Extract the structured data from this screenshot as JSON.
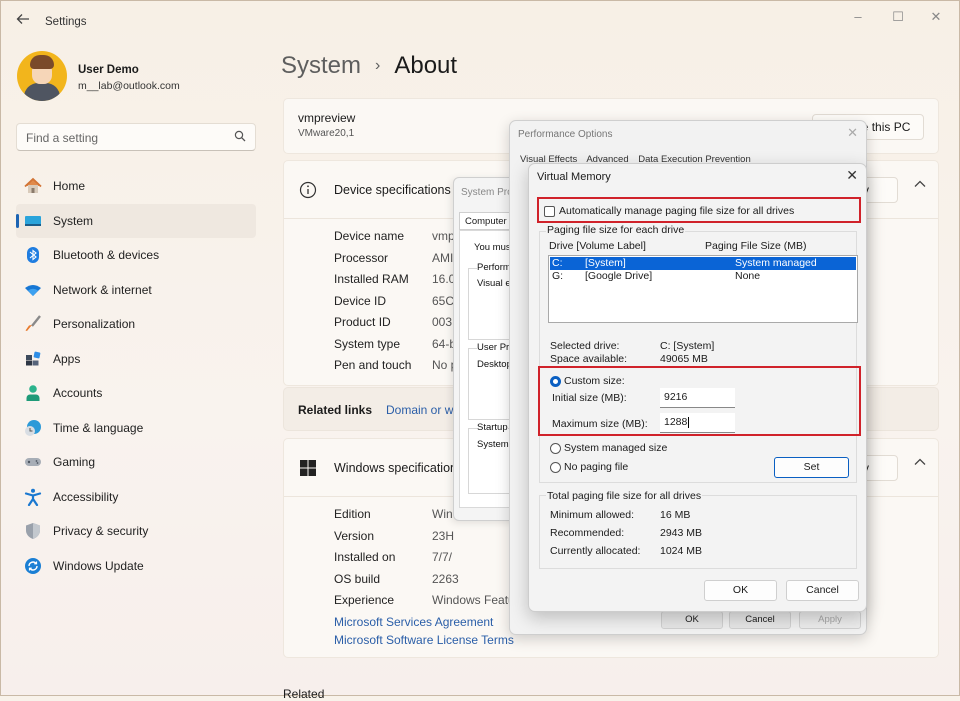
{
  "titlebar": {
    "app_title": "Settings",
    "back_icon": "arrow-left",
    "minimize_icon": "–",
    "maximize_icon": "☐",
    "close_icon": "✕"
  },
  "user": {
    "name": "User Demo",
    "email": "m__lab@outlook.com"
  },
  "search": {
    "placeholder": "Find a setting",
    "icon": "search-icon"
  },
  "sidebar": {
    "items": [
      {
        "label": "Home",
        "icon": "home-icon",
        "active": false
      },
      {
        "label": "System",
        "icon": "system-icon",
        "active": true
      },
      {
        "label": "Bluetooth & devices",
        "icon": "bluetooth-icon",
        "active": false
      },
      {
        "label": "Network & internet",
        "icon": "wifi-icon",
        "active": false
      },
      {
        "label": "Personalization",
        "icon": "brush-icon",
        "active": false
      },
      {
        "label": "Apps",
        "icon": "apps-icon",
        "active": false
      },
      {
        "label": "Accounts",
        "icon": "accounts-icon",
        "active": false
      },
      {
        "label": "Time & language",
        "icon": "time-language-icon",
        "active": false
      },
      {
        "label": "Gaming",
        "icon": "gamepad-icon",
        "active": false
      },
      {
        "label": "Accessibility",
        "icon": "accessibility-icon",
        "active": false
      },
      {
        "label": "Privacy & security",
        "icon": "shield-icon",
        "active": false
      },
      {
        "label": "Windows Update",
        "icon": "update-icon",
        "active": false
      }
    ]
  },
  "breadcrumb": {
    "parent": "System",
    "separator": "›",
    "current": "About"
  },
  "pc_card": {
    "name": "vmpreview",
    "model": "VMware20,1",
    "rename_label": "Rename this PC"
  },
  "device_specs": {
    "title": "Device specifications",
    "copy_label": "Copy",
    "rows": [
      {
        "label": "Device name",
        "value": "vmp"
      },
      {
        "label": "Processor",
        "value": "AMI"
      },
      {
        "label": "Installed RAM",
        "value": "16.0"
      },
      {
        "label": "Device ID",
        "value": "65C"
      },
      {
        "label": "Product ID",
        "value": "003"
      },
      {
        "label": "System type",
        "value": "64-b"
      },
      {
        "label": "Pen and touch",
        "value": "No p"
      }
    ]
  },
  "related_links": {
    "label": "Related links",
    "link": "Domain or w"
  },
  "windows_specs": {
    "title": "Windows specifications",
    "copy_label": "Copy",
    "rows": [
      {
        "label": "Edition",
        "value": "Win"
      },
      {
        "label": "Version",
        "value": "23H"
      },
      {
        "label": "Installed on",
        "value": "7/7/"
      },
      {
        "label": "OS build",
        "value": "2263"
      },
      {
        "label": "Experience",
        "value": "Windows Featu"
      }
    ],
    "links": [
      "Microsoft Services Agreement",
      "Microsoft Software License Terms"
    ]
  },
  "related_footer": "Related",
  "system_properties": {
    "title": "System Pro",
    "tab": "Computer N",
    "intro": "You mus",
    "groups": [
      {
        "label": "Perform",
        "text": "Visual e"
      },
      {
        "label": "User Pr",
        "text": "Desktop"
      },
      {
        "label": "Startup",
        "text": "System"
      }
    ]
  },
  "performance_options": {
    "title": "Performance Options",
    "tabs": [
      "Visual Effects",
      "Advanced",
      "Data Execution Prevention"
    ],
    "buttons": {
      "ok": "OK",
      "cancel": "Cancel",
      "apply": "Apply"
    }
  },
  "virtual_memory": {
    "title": "Virtual Memory",
    "auto_manage_label": "Automatically manage paging file size for all drives",
    "auto_manage_checked": false,
    "group_label": "Paging file size for each drive",
    "col_drive": "Drive  [Volume Label]",
    "col_size": "Paging File Size (MB)",
    "drives": [
      {
        "letter": "C:",
        "label": "[System]",
        "size": "System managed",
        "selected": true
      },
      {
        "letter": "G:",
        "label": "[Google Drive]",
        "size": "None",
        "selected": false
      }
    ],
    "selected_drive_label": "Selected drive:",
    "selected_drive_value": "C:  [System]",
    "space_available_label": "Space available:",
    "space_available_value": "49065 MB",
    "custom_size_label": "Custom size:",
    "custom_size_selected": true,
    "initial_size_label": "Initial size (MB):",
    "initial_size_value": "9216",
    "maximum_size_label": "Maximum size (MB):",
    "maximum_size_value": "1288",
    "system_managed_label": "System managed size",
    "no_paging_label": "No paging file",
    "set_label": "Set",
    "total_group_label": "Total paging file size for all drives",
    "minimum_allowed_label": "Minimum allowed:",
    "minimum_allowed_value": "16 MB",
    "recommended_label": "Recommended:",
    "recommended_value": "2943 MB",
    "currently_allocated_label": "Currently allocated:",
    "currently_allocated_value": "1024 MB",
    "ok_label": "OK",
    "cancel_label": "Cancel",
    "highlight_color": "#d0222a"
  }
}
